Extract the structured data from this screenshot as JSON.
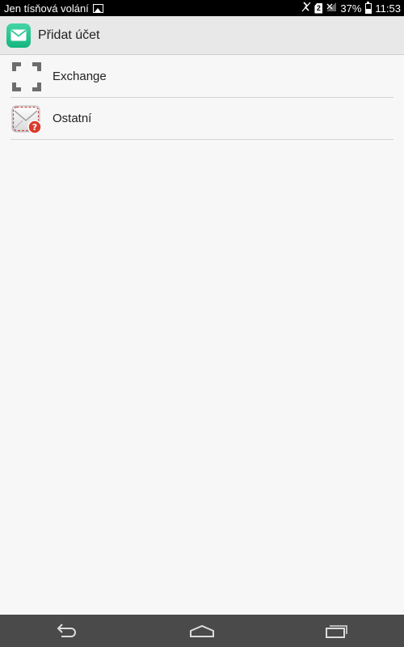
{
  "status_bar": {
    "carrier_text": "Jen tísňová volání",
    "battery_percent": "37%",
    "time": "11:53",
    "sim_label": "2",
    "icons": [
      "image-icon",
      "no-vibrate-icon",
      "sim-icon",
      "no-signal-icon",
      "battery-icon"
    ]
  },
  "action_bar": {
    "title": "Přidat účet",
    "icon": "mail-app-icon"
  },
  "accounts": [
    {
      "label": "Exchange",
      "icon": "exchange-icon"
    },
    {
      "label": "Ostatní",
      "icon": "other-mail-icon"
    }
  ],
  "nav_bar": {
    "icons": [
      "back-icon",
      "home-icon",
      "recent-apps-icon"
    ]
  },
  "colors": {
    "status_bar_bg": "#000000",
    "action_bar_bg": "#e8e8e8",
    "content_bg": "#f7f7f7",
    "nav_bar_bg": "#4a4a4a",
    "app_icon_green": "#1fbf8a",
    "badge_red": "#d93a2b"
  }
}
